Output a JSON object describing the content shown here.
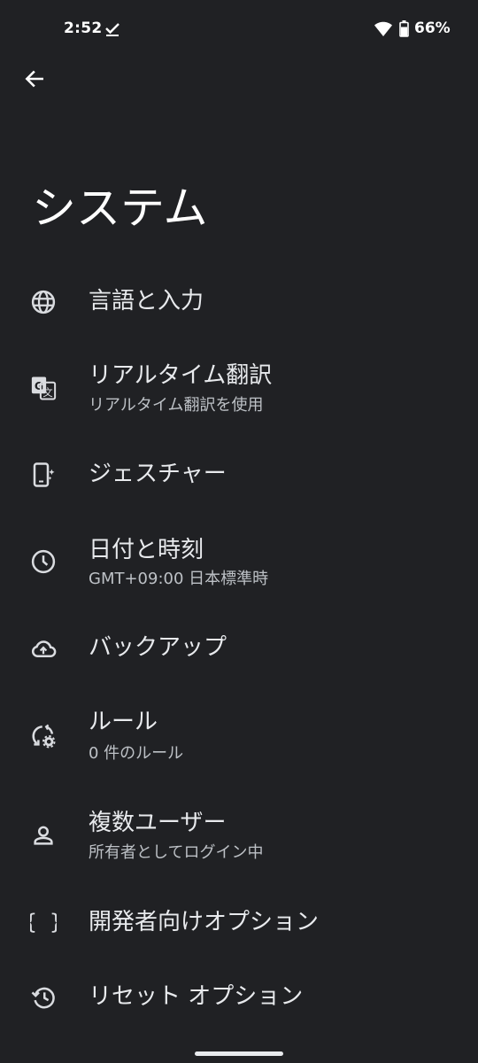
{
  "status_bar": {
    "time": "2:52",
    "battery_percent": "66%",
    "icons": [
      "download-done-icon",
      "wifi-icon",
      "battery-icon"
    ]
  },
  "header": {
    "back_icon": "arrow-back-icon",
    "title": "システム"
  },
  "items": [
    {
      "icon": "globe-icon",
      "title": "言語と入力",
      "summary": ""
    },
    {
      "icon": "translate-icon",
      "title": "リアルタイム翻訳",
      "summary": "リアルタイム翻訳を使用"
    },
    {
      "icon": "gesture-phone-icon",
      "title": "ジェスチャー",
      "summary": ""
    },
    {
      "icon": "clock-icon",
      "title": "日付と時刻",
      "summary": "GMT+09:00 日本標準時"
    },
    {
      "icon": "cloud-upload-icon",
      "title": "バックアップ",
      "summary": ""
    },
    {
      "icon": "rules-icon",
      "title": "ルール",
      "summary": "0 件のルール"
    },
    {
      "icon": "person-icon",
      "title": "複数ユーザー",
      "summary": "所有者としてログイン中"
    },
    {
      "icon": "braces-icon",
      "title": "開発者向けオプション",
      "summary": ""
    },
    {
      "icon": "history-icon",
      "title": "リセット オプション",
      "summary": ""
    }
  ],
  "colors": {
    "background": "#202124",
    "text_primary": "#e8eaed",
    "text_secondary": "#bdc1c6",
    "icon": "#dadce0"
  }
}
